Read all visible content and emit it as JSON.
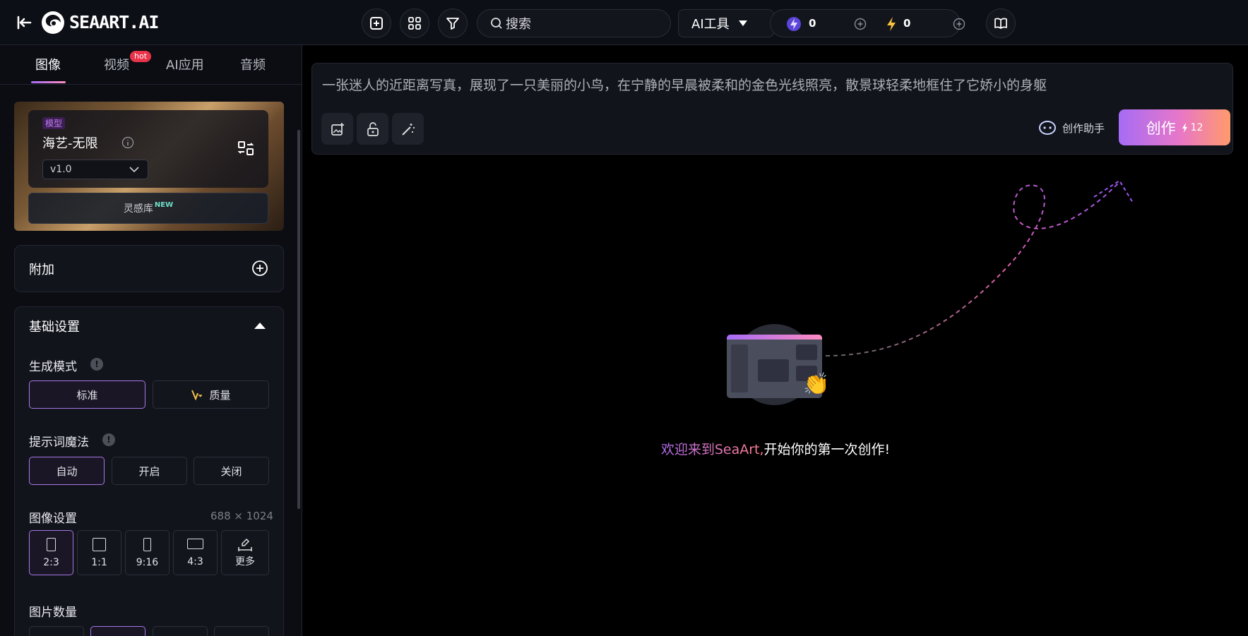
{
  "header": {
    "logo_text": "SEAART.AI",
    "search_placeholder": "搜索",
    "ai_tools_label": "AI工具",
    "credits_a": "0",
    "credits_b": "0"
  },
  "tabs": [
    {
      "label": "图像",
      "active": true
    },
    {
      "label": "视频",
      "badge": "hot"
    },
    {
      "label": "AI应用"
    },
    {
      "label": "音频"
    }
  ],
  "model": {
    "tag": "模型",
    "name": "海艺-无限",
    "version": "v1.0",
    "inspiration_label": "灵感库",
    "inspiration_badge": "NEW"
  },
  "addon": {
    "label": "附加"
  },
  "basic": {
    "title": "基础设置",
    "gen_mode_label": "生成模式",
    "gen_modes": [
      "标准",
      "质量"
    ],
    "prompt_magic_label": "提示词魔法",
    "prompt_magic_options": [
      "自动",
      "开启",
      "关闭"
    ],
    "image_settings_label": "图像设置",
    "image_size": "688 × 1024",
    "ratios": [
      "2:3",
      "1:1",
      "9:16",
      "4:3",
      "更多"
    ],
    "image_count_label": "图片数量"
  },
  "prompt": {
    "text": "一张迷人的近距离写真，展现了一只美丽的小鸟，在宁静的早晨被柔和的金色光线照亮，散景球轻柔地框住了它娇小的身躯",
    "assistant_label": "创作助手",
    "create_label": "创作",
    "create_cost": "12"
  },
  "welcome": {
    "highlight": "欢迎来到SeaArt,",
    "rest": "开始你的第一次创作!"
  },
  "colors": {
    "accent_purple": "#a777e6",
    "accent_gradient_start": "#a66cf5",
    "accent_gradient_end": "#ff9a6b",
    "hot_badge": "#e8334a",
    "new_badge": "#6fe0c8"
  }
}
